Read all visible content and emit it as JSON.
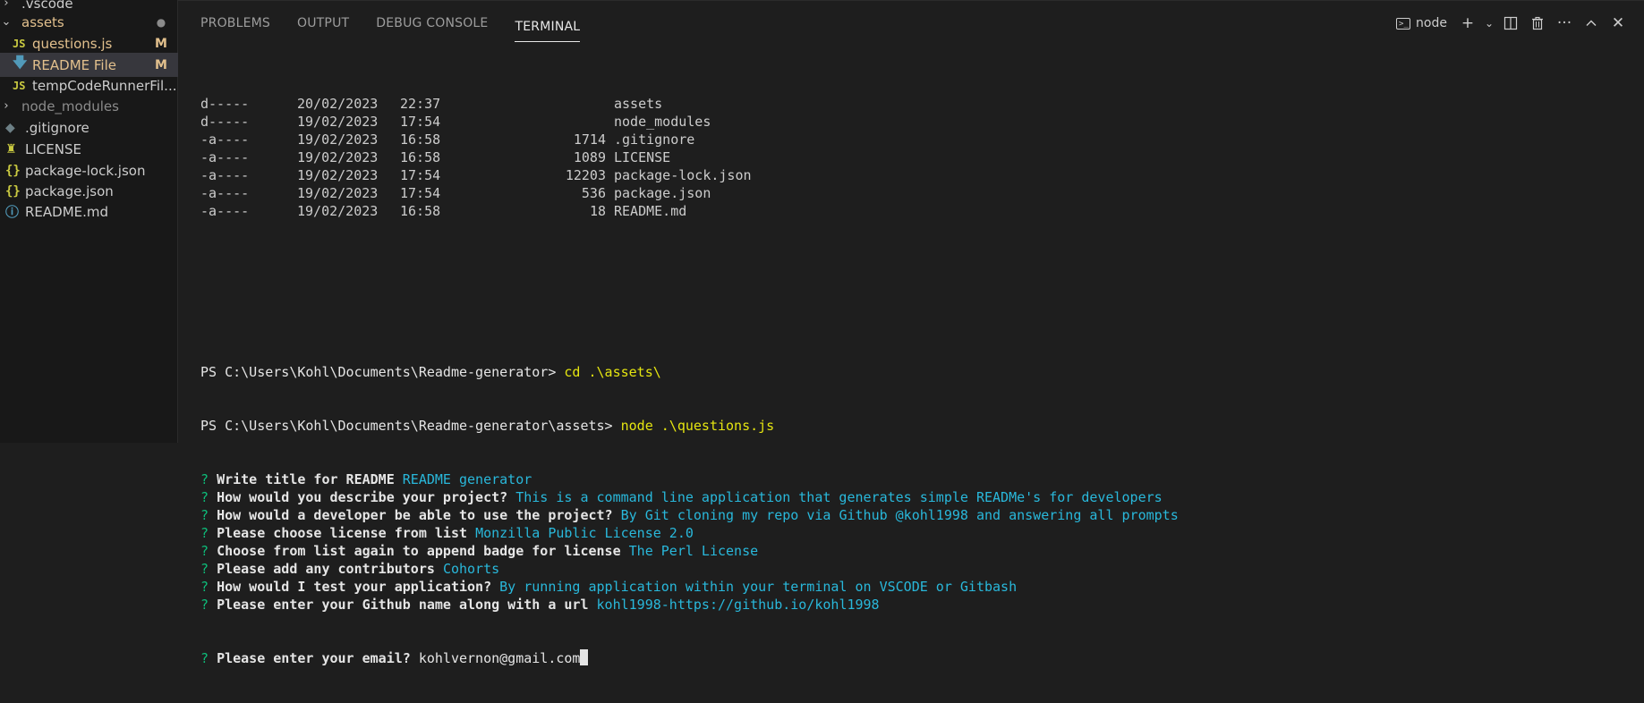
{
  "sidebar": {
    "vscode_label": ".vscode",
    "assets_folder": "assets",
    "files_in_assets": [
      {
        "icon": "JS",
        "label": "questions.js",
        "badge": "M"
      },
      {
        "icon": "arrow-down-icon",
        "label": "README File",
        "badge": "M"
      },
      {
        "icon": "JS",
        "label": "tempCodeRunnerFil..."
      }
    ],
    "node_modules": "node_modules",
    "root_files": [
      {
        "label": ".gitignore"
      },
      {
        "label": "LICENSE"
      },
      {
        "label": "package-lock.json"
      },
      {
        "label": "package.json"
      },
      {
        "label": "README.md"
      }
    ]
  },
  "panel": {
    "tabs": [
      "PROBLEMS",
      "OUTPUT",
      "DEBUG CONSOLE",
      "TERMINAL"
    ],
    "active_tab": "TERMINAL",
    "terminal_name": "node"
  },
  "terminal": {
    "listing": [
      {
        "mode": "d-----",
        "date": "20/02/2023",
        "time": "22:37",
        "length": "",
        "name": "assets"
      },
      {
        "mode": "d-----",
        "date": "19/02/2023",
        "time": "17:54",
        "length": "",
        "name": "node_modules"
      },
      {
        "mode": "-a----",
        "date": "19/02/2023",
        "time": "16:58",
        "length": "1714",
        "name": ".gitignore"
      },
      {
        "mode": "-a----",
        "date": "19/02/2023",
        "time": "16:58",
        "length": "1089",
        "name": "LICENSE"
      },
      {
        "mode": "-a----",
        "date": "19/02/2023",
        "time": "17:54",
        "length": "12203",
        "name": "package-lock.json"
      },
      {
        "mode": "-a----",
        "date": "19/02/2023",
        "time": "17:54",
        "length": "536",
        "name": "package.json"
      },
      {
        "mode": "-a----",
        "date": "19/02/2023",
        "time": "16:58",
        "length": "18",
        "name": "README.md"
      }
    ],
    "prompt1": "PS C:\\Users\\Kohl\\Documents\\Readme-generator> ",
    "cmd1": "cd .\\assets\\",
    "prompt2": "PS C:\\Users\\Kohl\\Documents\\Readme-generator\\assets> ",
    "cmd2": "node .\\questions.js",
    "qa": [
      {
        "q": "Write title for README",
        "a": "README generator"
      },
      {
        "q": "How would you describe your project?",
        "a": "This is a command line application that generates simple READMe's for developers"
      },
      {
        "q": "How would a developer be able to use the project?",
        "a": "By Git cloning my repo via Github @kohl1998 and answering all prompts"
      },
      {
        "q": "Please choose license from list",
        "a": "Monzilla Public License 2.0"
      },
      {
        "q": "Choose from list again to append badge for license",
        "a": "The Perl License"
      },
      {
        "q": "Please add any contributors",
        "a": "Cohorts"
      },
      {
        "q": "How would I test your application?",
        "a": "By running application within your terminal on VSCODE or Gitbash"
      },
      {
        "q": "Please enter your Github name along with a url",
        "a": "kohl1998-https://github.io/kohl1998"
      }
    ],
    "current_q": "Please enter your email?",
    "current_input": "kohlvernon@gmail.com",
    "qmark": "?"
  },
  "colors": {
    "background": "#1e1e1e",
    "sidebar": "#181818",
    "command_yellow": "#e5e510",
    "answer_cyan": "#29b8db",
    "qmark_green": "#0dbc79",
    "modified": "#e2c08d"
  }
}
